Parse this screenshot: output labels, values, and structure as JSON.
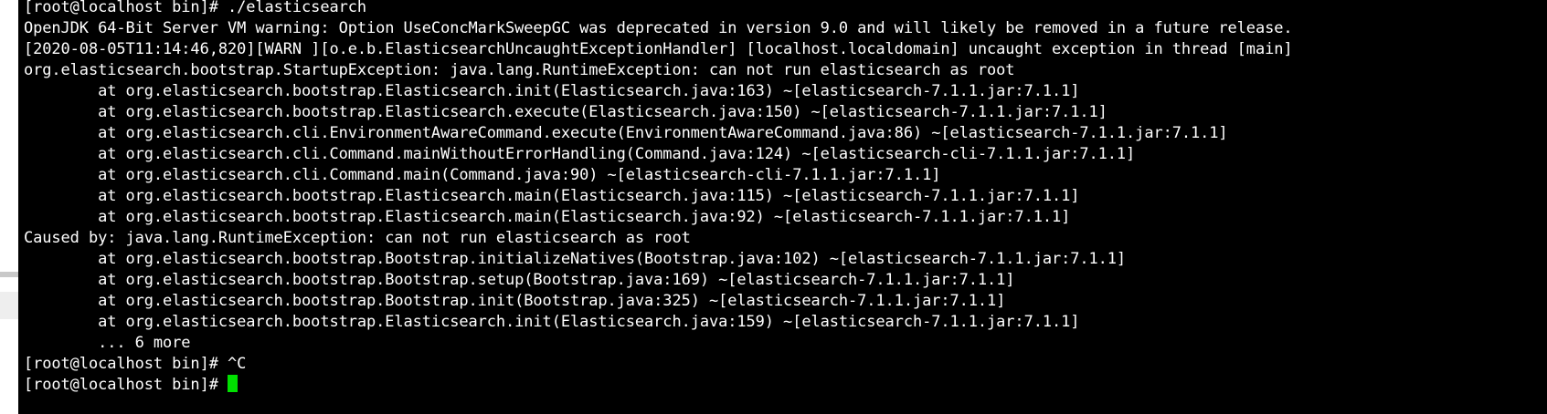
{
  "colors": {
    "terminal_bg": "#000000",
    "terminal_fg": "#ffffff",
    "cursor": "#00e000"
  },
  "terminal": {
    "lines": [
      "[root@localhost bin]# ./elasticsearch",
      "OpenJDK 64-Bit Server VM warning: Option UseConcMarkSweepGC was deprecated in version 9.0 and will likely be removed in a future release.",
      "[2020-08-05T11:14:46,820][WARN ][o.e.b.ElasticsearchUncaughtExceptionHandler] [localhost.localdomain] uncaught exception in thread [main]",
      "org.elasticsearch.bootstrap.StartupException: java.lang.RuntimeException: can not run elasticsearch as root",
      "        at org.elasticsearch.bootstrap.Elasticsearch.init(Elasticsearch.java:163) ~[elasticsearch-7.1.1.jar:7.1.1]",
      "        at org.elasticsearch.bootstrap.Elasticsearch.execute(Elasticsearch.java:150) ~[elasticsearch-7.1.1.jar:7.1.1]",
      "        at org.elasticsearch.cli.EnvironmentAwareCommand.execute(EnvironmentAwareCommand.java:86) ~[elasticsearch-7.1.1.jar:7.1.1]",
      "        at org.elasticsearch.cli.Command.mainWithoutErrorHandling(Command.java:124) ~[elasticsearch-cli-7.1.1.jar:7.1.1]",
      "        at org.elasticsearch.cli.Command.main(Command.java:90) ~[elasticsearch-cli-7.1.1.jar:7.1.1]",
      "        at org.elasticsearch.bootstrap.Elasticsearch.main(Elasticsearch.java:115) ~[elasticsearch-7.1.1.jar:7.1.1]",
      "        at org.elasticsearch.bootstrap.Elasticsearch.main(Elasticsearch.java:92) ~[elasticsearch-7.1.1.jar:7.1.1]",
      "Caused by: java.lang.RuntimeException: can not run elasticsearch as root",
      "        at org.elasticsearch.bootstrap.Bootstrap.initializeNatives(Bootstrap.java:102) ~[elasticsearch-7.1.1.jar:7.1.1]",
      "        at org.elasticsearch.bootstrap.Bootstrap.setup(Bootstrap.java:169) ~[elasticsearch-7.1.1.jar:7.1.1]",
      "        at org.elasticsearch.bootstrap.Bootstrap.init(Bootstrap.java:325) ~[elasticsearch-7.1.1.jar:7.1.1]",
      "        at org.elasticsearch.bootstrap.Elasticsearch.init(Elasticsearch.java:159) ~[elasticsearch-7.1.1.jar:7.1.1]",
      "        ... 6 more",
      "[root@localhost bin]# ^C"
    ],
    "prompt": "[root@localhost bin]# "
  }
}
